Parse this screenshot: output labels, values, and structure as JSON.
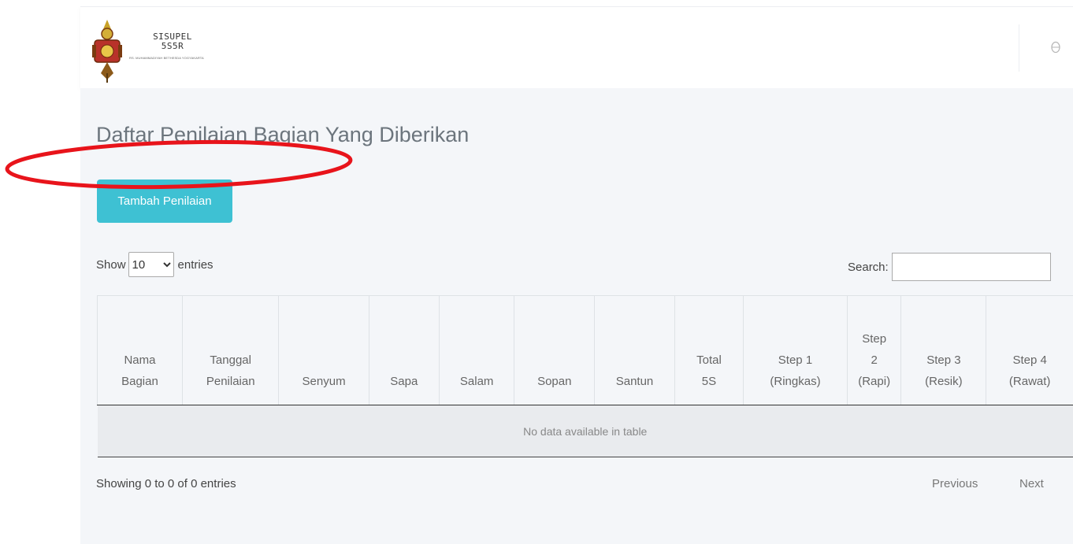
{
  "header": {
    "logo_title_line1": "SISUPEL",
    "logo_title_line2": "5S5R",
    "logo_subtitle": "RS. MUHAMMADIYAH BETHESDA YOGYAKARTA",
    "user_icon": "user-circle-icon"
  },
  "main": {
    "page_title": "Daftar Penilaian Bagian Yang Diberikan",
    "add_button_label": "Tambah Penilaian"
  },
  "table_controls": {
    "show_label": "Show",
    "entries_label": "entries",
    "page_length_value": "10",
    "search_label": "Search:",
    "search_value": ""
  },
  "table": {
    "columns": [
      [
        "Nama",
        "Bagian"
      ],
      [
        "Tanggal",
        "Penilaian"
      ],
      [
        "Senyum"
      ],
      [
        "Sapa"
      ],
      [
        "Salam"
      ],
      [
        "Sopan"
      ],
      [
        "Santun"
      ],
      [
        "Total",
        "5S"
      ],
      [
        "Step 1",
        "(Ringkas)"
      ],
      [
        "Step",
        "2",
        "(Rapi)"
      ],
      [
        "Step 3",
        "(Resik)"
      ],
      [
        "Step 4",
        "(Rawat)"
      ]
    ],
    "empty_message": "No data available in table"
  },
  "footer": {
    "info": "Showing 0 to 0 of 0 entries",
    "previous_label": "Previous",
    "next_label": "Next"
  },
  "colors": {
    "accent_button": "#3ec1d3",
    "annotation": "#e8141b",
    "content_background": "#f4f6f9"
  }
}
